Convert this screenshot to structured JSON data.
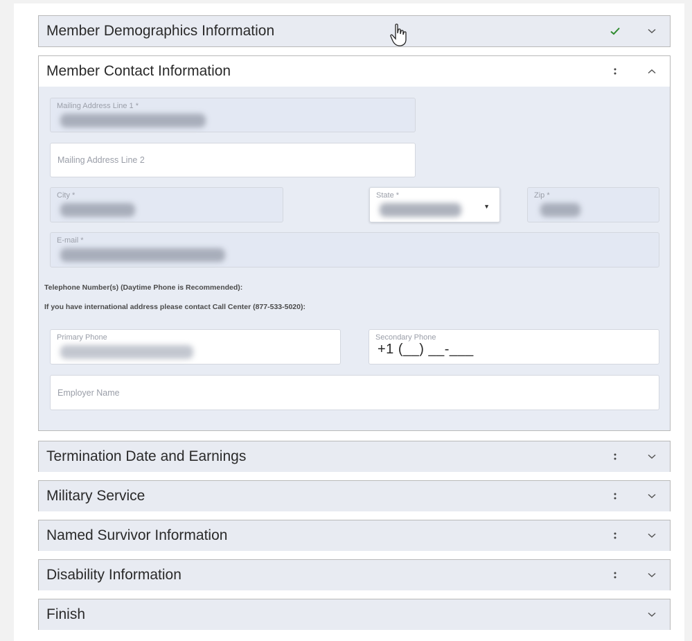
{
  "panels": {
    "demographics": {
      "title": "Member Demographics Information",
      "status": "check"
    },
    "contact": {
      "title": "Member Contact Information",
      "status": "drag"
    },
    "termination": {
      "title": "Termination Date and Earnings",
      "status": "drag"
    },
    "military": {
      "title": "Military Service",
      "status": "drag"
    },
    "survivor": {
      "title": "Named Survivor Information",
      "status": "drag"
    },
    "disability": {
      "title": "Disability Information",
      "status": "drag"
    },
    "finish": {
      "title": "Finish",
      "status": "none"
    }
  },
  "form": {
    "mailing1_label": "Mailing Address Line 1 *",
    "mailing2_placeholder": "Mailing Address Line 2",
    "city_label": "City *",
    "state_label": "State *",
    "zip_label": "Zip *",
    "email_label": "E-mail *",
    "phone_note": "Telephone Number(s) (Daytime Phone is Recommended):",
    "intl_note": "If you have international address please contact Call Center (877-533-5020):",
    "primary_phone_label": "Primary Phone",
    "secondary_phone_label": "Secondary Phone",
    "secondary_phone_value": "+1 (__) __-___",
    "employer_placeholder": "Employer Name"
  },
  "colors": {
    "header_bg": "#e8ebf2",
    "body_bg": "#e8ecf4",
    "check": "#2e8b2e",
    "border": "#b9b9b9"
  }
}
